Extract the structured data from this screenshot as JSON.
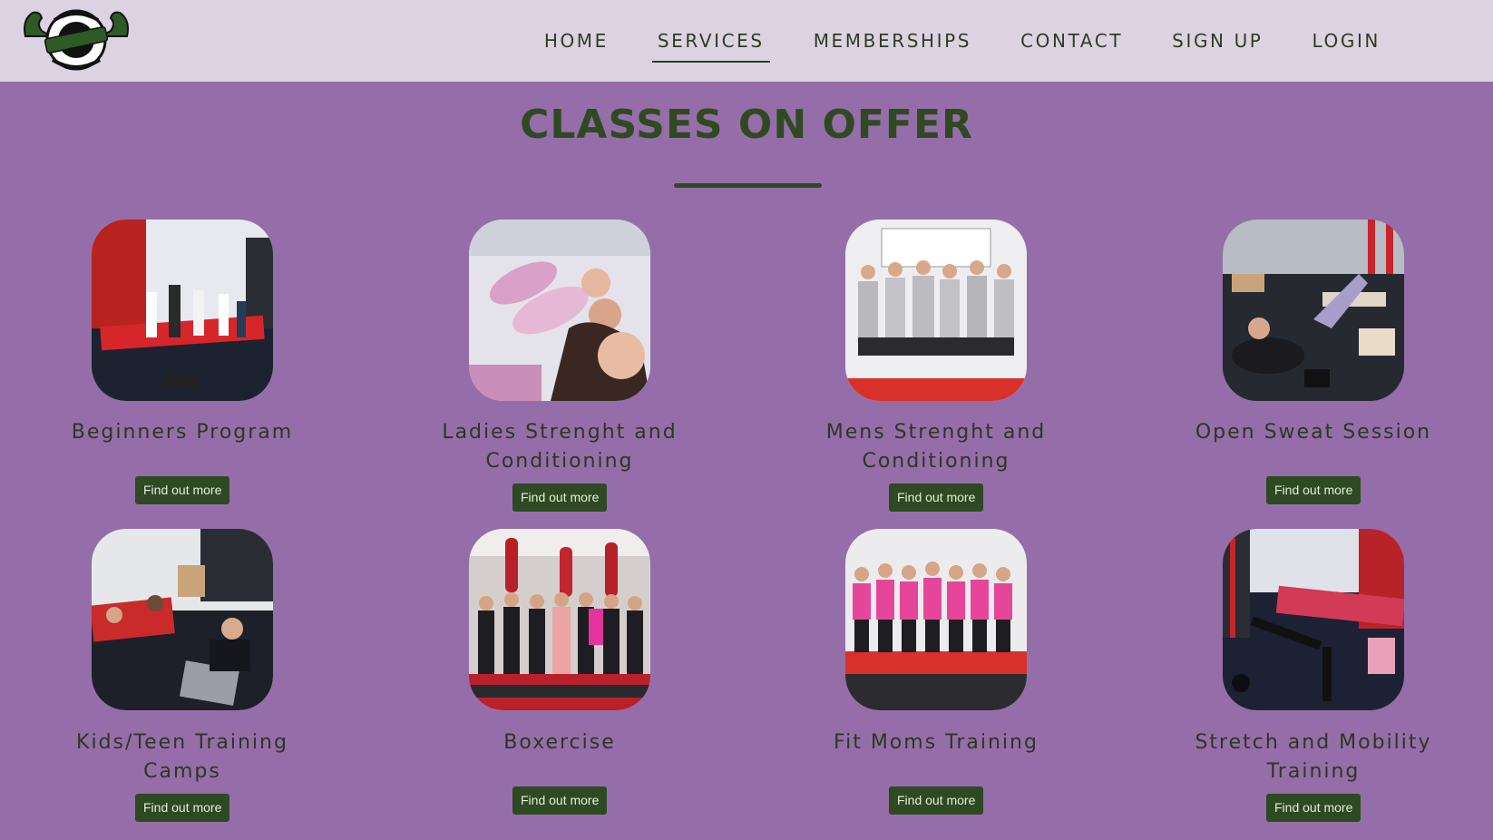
{
  "site": {
    "logo": {
      "name": "logo-emblem"
    },
    "nav": [
      {
        "label": "HOME",
        "active": false
      },
      {
        "label": "SERVICES",
        "active": true
      },
      {
        "label": "MEMBERSHIPS",
        "active": false
      },
      {
        "label": "CONTACT",
        "active": false
      },
      {
        "label": "SIGN UP",
        "active": false
      },
      {
        "label": "LOGIN",
        "active": false
      }
    ]
  },
  "page": {
    "title": "CLASSES ON OFFER",
    "accent_color": "#2f4a21",
    "background_color": "#956ea9",
    "header_color": "#dcd3e2"
  },
  "classes": [
    {
      "title": "Beginners Program",
      "button": "Find out more"
    },
    {
      "title": "Ladies Strenght and Conditioning",
      "button": "Find out more"
    },
    {
      "title": "Mens Strenght and Conditioning",
      "button": "Find out more"
    },
    {
      "title": "Open Sweat Session",
      "button": "Find out more"
    },
    {
      "title": "Kids/Teen Training Camps",
      "button": "Find out more"
    },
    {
      "title": "Boxercise",
      "button": "Find out more"
    },
    {
      "title": "Fit Moms Training",
      "button": "Find out more"
    },
    {
      "title": "Stretch and Mobility Training",
      "button": "Find out more"
    }
  ]
}
